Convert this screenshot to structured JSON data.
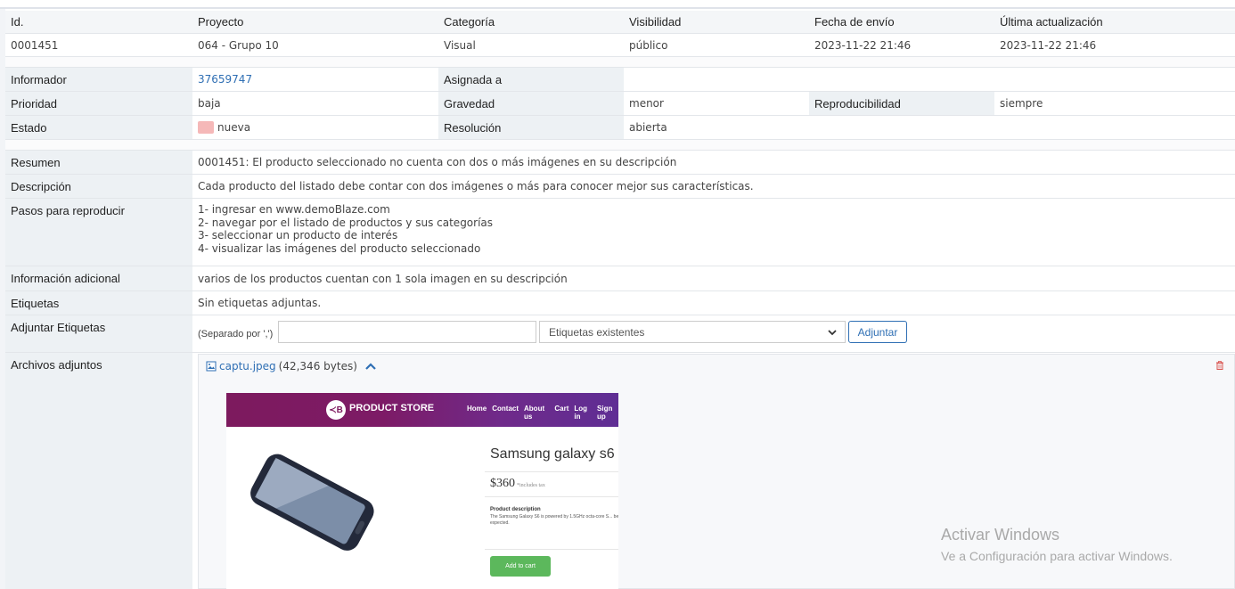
{
  "header": {
    "id": "Id.",
    "project": "Proyecto",
    "category": "Categoría",
    "visibility": "Visibilidad",
    "submitted": "Fecha de envío",
    "updated": "Última actualización"
  },
  "issue": {
    "id": "0001451",
    "project": "064 - Grupo 10",
    "category": "Visual",
    "visibility": "público",
    "submitted": "2023-11-22 21:46",
    "updated": "2023-11-22 21:46"
  },
  "details": {
    "reporter_label": "Informador",
    "reporter": "37659747",
    "assigned_label": "Asignada a",
    "assigned": "",
    "priority_label": "Prioridad",
    "priority": "baja",
    "severity_label": "Gravedad",
    "severity": "menor",
    "reproducibility_label": "Reproducibilidad",
    "reproducibility": "siempre",
    "status_label": "Estado",
    "status": "nueva",
    "status_color": "#f5b8b8",
    "resolution_label": "Resolución",
    "resolution": "abierta"
  },
  "text": {
    "summary_label": "Resumen",
    "summary": "0001451: El producto seleccionado no cuenta con dos o más imágenes en su descripción",
    "description_label": "Descripción",
    "description": "Cada producto del listado debe contar con dos imágenes o más para conocer mejor sus características.",
    "steps_label": "Pasos para reproducir",
    "steps": [
      "1- ingresar en www.demoBlaze.com",
      "2- navegar por el listado de productos y sus categorías",
      "3- seleccionar un producto de interés",
      "4- visualizar las imágenes del producto seleccionado"
    ],
    "additional_label": "Información adicional",
    "additional": "varios de los productos cuentan con 1 sola imagen en su descripción",
    "tags_label": "Etiquetas",
    "tags": "Sin etiquetas adjuntas.",
    "attach_tags_label": "Adjuntar Etiquetas",
    "tag_hint": "(Separado por ',')",
    "tag_input_value": "",
    "existing_tags": "Etiquetas existentes",
    "attach_button": "Adjuntar",
    "files_label": "Archivos adjuntos"
  },
  "attachment": {
    "filename": "captu.jpeg",
    "size": "(42,346 bytes)",
    "preview": {
      "logo": "≺B",
      "brand": "PRODUCT STORE",
      "nav": [
        "Home",
        "Contact",
        "About us",
        "Cart",
        "Log in",
        "Sign up"
      ],
      "product": "Samsung galaxy s6",
      "price": "$360",
      "tax": "*includes tax",
      "desc_title": "Product description",
      "desc_text": "The Samsung Galaxy S6 is powered by 1.5GHz octa-core S... be expected.",
      "cart": "Add to cart"
    }
  },
  "watermark": {
    "line1": "Activar Windows",
    "line2": "Ve a Configuración para activar Windows."
  },
  "colors": {
    "link": "#2f6fb4",
    "label_bg": "#edf1f4",
    "header_bg": "#f4f6f8"
  }
}
